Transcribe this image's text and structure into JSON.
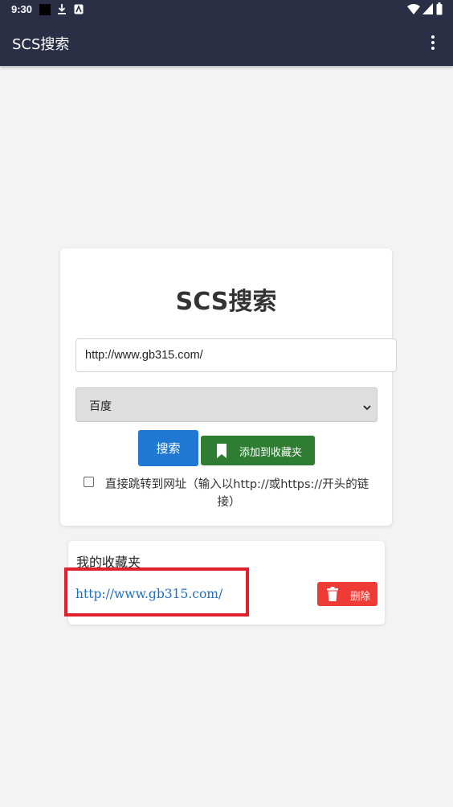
{
  "status_bar": {
    "time": "9:30",
    "icons": [
      "stop-square-icon",
      "download-icon",
      "accessibility-icon",
      "wifi-icon",
      "signal-icon",
      "battery-icon"
    ]
  },
  "app_bar": {
    "title": "SCS搜索",
    "menu_icon": "more-vertical-icon"
  },
  "search_card": {
    "heading": "SCS搜索",
    "url_value": "http://www.gb315.com/",
    "engine_selected": "百度",
    "search_label": "搜索",
    "add_fav_label": "添加到收藏夹",
    "jump_label": "直接跳转到网址（输入以http://或https://开头的链接）",
    "jump_checked": false
  },
  "favorites": {
    "title": "我的收藏夹",
    "items": [
      {
        "url": "http://www.gb315.com/",
        "delete_label": "删除"
      }
    ]
  },
  "colors": {
    "app_bar": "#2b2f45",
    "search_button": "#1f79d2",
    "fav_button": "#2e7d32",
    "delete_button": "#ef3b36",
    "link": "#1f6fbf",
    "highlight": "#e0202c"
  }
}
